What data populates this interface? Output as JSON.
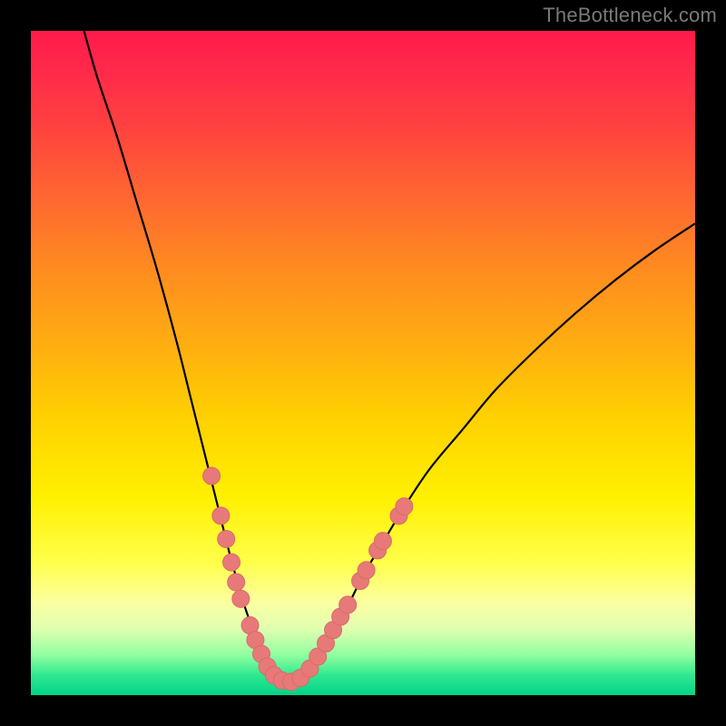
{
  "watermark": "TheBottleneck.com",
  "colors": {
    "background": "#000000",
    "curve": "#000000",
    "marker_fill": "#e77a78",
    "marker_stroke": "#d86a68",
    "gradient_stops": [
      {
        "offset": 0.0,
        "color": "#ff1a4a"
      },
      {
        "offset": 0.14,
        "color": "#ff4040"
      },
      {
        "offset": 0.36,
        "color": "#ff8c20"
      },
      {
        "offset": 0.58,
        "color": "#ffd000"
      },
      {
        "offset": 0.8,
        "color": "#ffff4a"
      },
      {
        "offset": 0.94,
        "color": "#90ffa0"
      },
      {
        "offset": 1.0,
        "color": "#00d488"
      }
    ]
  },
  "chart_data": {
    "type": "line",
    "title": "",
    "xlabel": "",
    "ylabel": "",
    "xlim": [
      0,
      100
    ],
    "ylim": [
      0,
      100
    ],
    "series": [
      {
        "name": "bottleneck-curve",
        "x": [
          8,
          10,
          13,
          16,
          19,
          22,
          24,
          26,
          28,
          30,
          32,
          33,
          34,
          35,
          36,
          37,
          38,
          39,
          40,
          42,
          44,
          46,
          48,
          50,
          53,
          56,
          60,
          65,
          70,
          76,
          82,
          88,
          94,
          100
        ],
        "y": [
          100,
          93,
          84,
          74,
          64,
          53,
          45,
          37,
          29,
          21,
          14,
          11,
          8,
          6,
          4,
          2.5,
          2,
          2,
          2.5,
          4,
          7,
          10.5,
          14,
          18,
          23,
          28,
          34,
          40,
          46,
          52,
          57.5,
          62.5,
          67,
          71
        ]
      }
    ],
    "markers": {
      "name": "highlight-dots",
      "points": [
        {
          "x": 27.2,
          "y": 33.0
        },
        {
          "x": 28.6,
          "y": 27.0
        },
        {
          "x": 29.4,
          "y": 23.5
        },
        {
          "x": 30.2,
          "y": 20.0
        },
        {
          "x": 30.9,
          "y": 17.0
        },
        {
          "x": 31.6,
          "y": 14.5
        },
        {
          "x": 33.0,
          "y": 10.5
        },
        {
          "x": 33.8,
          "y": 8.3
        },
        {
          "x": 34.7,
          "y": 6.2
        },
        {
          "x": 35.6,
          "y": 4.3
        },
        {
          "x": 36.6,
          "y": 3.0
        },
        {
          "x": 37.8,
          "y": 2.2
        },
        {
          "x": 39.2,
          "y": 2.0
        },
        {
          "x": 40.6,
          "y": 2.6
        },
        {
          "x": 42.0,
          "y": 4.0
        },
        {
          "x": 43.2,
          "y": 5.8
        },
        {
          "x": 44.4,
          "y": 7.8
        },
        {
          "x": 45.5,
          "y": 9.8
        },
        {
          "x": 46.6,
          "y": 11.8
        },
        {
          "x": 47.7,
          "y": 13.6
        },
        {
          "x": 49.6,
          "y": 17.2
        },
        {
          "x": 50.5,
          "y": 18.8
        },
        {
          "x": 52.2,
          "y": 21.8
        },
        {
          "x": 53.0,
          "y": 23.2
        },
        {
          "x": 55.4,
          "y": 27.0
        },
        {
          "x": 56.2,
          "y": 28.4
        }
      ]
    }
  }
}
